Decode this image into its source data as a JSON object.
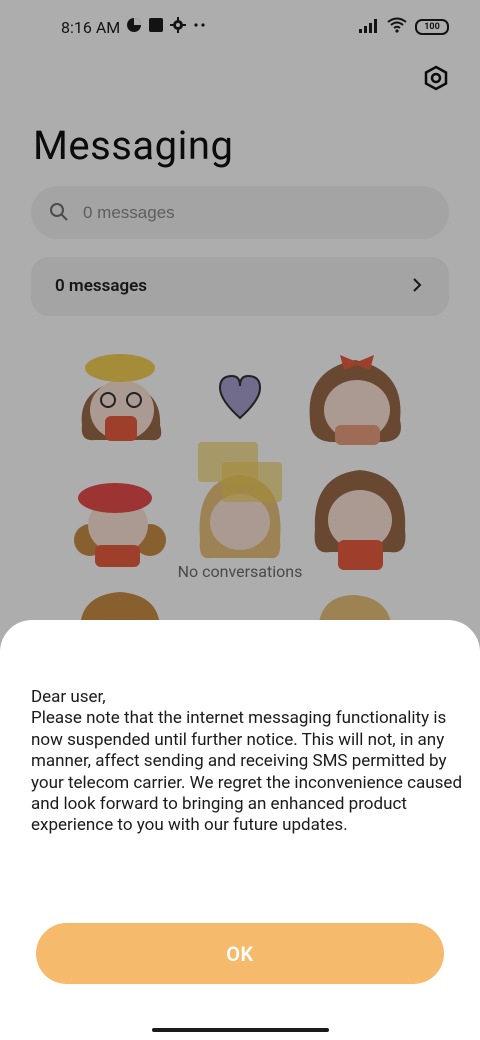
{
  "status": {
    "time": "8:16 AM",
    "battery": "100"
  },
  "header": {
    "title": "Messaging"
  },
  "search": {
    "placeholder": "0 messages"
  },
  "messages_row": {
    "label": "0 messages"
  },
  "empty_state": {
    "text": "No conversations"
  },
  "dialog": {
    "message": "Dear user,\nPlease note that the internet messaging functionality is now suspended until further notice. This will not, in any manner, affect sending and receiving SMS permitted by your telecom carrier. We regret the inconvenience caused and look forward to bringing an enhanced product experience to you with our future updates.",
    "ok_label": "OK"
  },
  "colors": {
    "accent": "#f6ba6c"
  }
}
